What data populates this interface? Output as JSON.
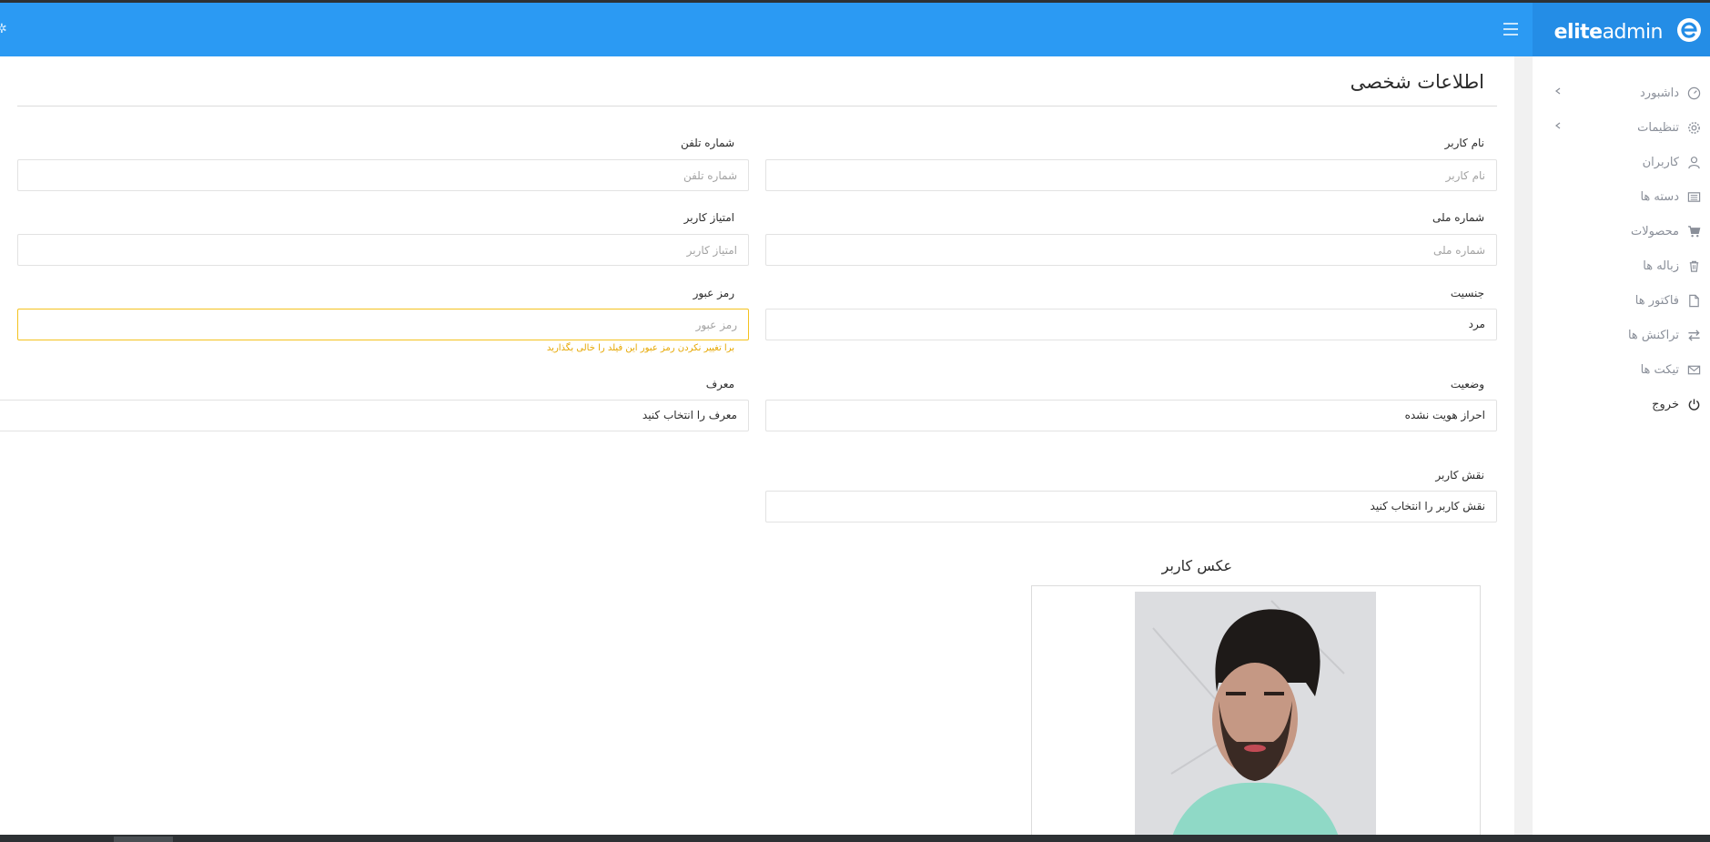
{
  "header": {
    "brand_bold": "elite",
    "brand_thin": "admin",
    "brand_color": "#2b9af3",
    "icons": [
      "menu-icon",
      "gear-icon"
    ]
  },
  "sidebar": {
    "items": [
      {
        "label": "داشبورد",
        "icon": "dashboard-icon",
        "has_submenu": true
      },
      {
        "label": "تنظیمات",
        "icon": "gear-icon",
        "has_submenu": true
      },
      {
        "label": "کاربران",
        "icon": "user-icon",
        "has_submenu": false
      },
      {
        "label": "دسته ها",
        "icon": "list-icon",
        "has_submenu": false
      },
      {
        "label": "محصولات",
        "icon": "cart-icon",
        "has_submenu": false
      },
      {
        "label": "زباله ها",
        "icon": "trash-icon",
        "has_submenu": false
      },
      {
        "label": "فاکتور ها",
        "icon": "file-icon",
        "has_submenu": false
      },
      {
        "label": "تراکنش ها",
        "icon": "exchange-icon",
        "has_submenu": false
      },
      {
        "label": "تیکت ها",
        "icon": "envelope-icon",
        "has_submenu": false
      },
      {
        "label": "خروج",
        "icon": "power-icon",
        "has_submenu": false
      }
    ]
  },
  "page": {
    "title": "اطلاعات شخصی"
  },
  "form": {
    "username": {
      "label": "نام کاربر",
      "placeholder": "نام کاربر",
      "value": ""
    },
    "phone": {
      "label": "شماره تلفن",
      "placeholder": "شماره تلفن",
      "value": ""
    },
    "national_id": {
      "label": "شماره ملی",
      "placeholder": "شماره ملی",
      "value": ""
    },
    "score": {
      "label": "امتیاز کاربر",
      "placeholder": "امتیاز کاربر",
      "value": ""
    },
    "gender": {
      "label": "جنسیت",
      "value": "مرد"
    },
    "password": {
      "label": "رمز عبور",
      "placeholder": "رمز عبور",
      "value": "",
      "hint": "برا تغییر نکردن رمز عبور این فیلد را خالی بگذارید"
    },
    "status": {
      "label": "وضعیت",
      "value": "احراز هویت نشده"
    },
    "referrer": {
      "label": "معرف",
      "value": "معرف را انتخاب کنید"
    },
    "role": {
      "label": "نقش کاربر",
      "value": "نقش کاربر را انتخاب کنید"
    }
  },
  "photo": {
    "title": "عکس کاربر"
  },
  "colors": {
    "accent": "#2b9af3",
    "warning": "#f4c21f",
    "hint": "#e6a700"
  }
}
